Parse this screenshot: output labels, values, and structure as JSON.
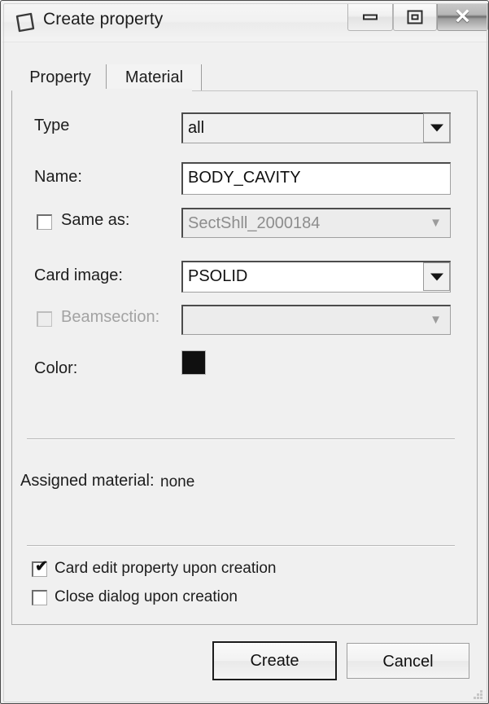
{
  "window": {
    "title": "Create property",
    "icon": "property-polygon-icon",
    "controls": {
      "minimize": "minimize-icon",
      "maximize": "maximize-icon",
      "close": "✕"
    }
  },
  "tabs": [
    {
      "label": "Property",
      "active": true
    },
    {
      "label": "Material",
      "active": false
    }
  ],
  "form": {
    "type": {
      "label": "Type",
      "value": "all",
      "enabled": true
    },
    "name": {
      "label": "Name:",
      "value": "BODY_CAVITY",
      "enabled": true
    },
    "same_as": {
      "label": "Same as:",
      "checked": false,
      "value": "SectShll_2000184",
      "enabled": false
    },
    "card_image": {
      "label": "Card image:",
      "value": "PSOLID",
      "enabled": true
    },
    "beamsection": {
      "label": "Beamsection:",
      "checked": false,
      "value": "",
      "enabled": false
    },
    "color": {
      "label": "Color:",
      "value": "#101010"
    },
    "assigned_material": {
      "label": "Assigned material:",
      "value": "none"
    }
  },
  "options": [
    {
      "label": "Card edit property upon creation",
      "checked": true
    },
    {
      "label": "Close dialog upon creation",
      "checked": false
    }
  ],
  "buttons": {
    "create": "Create",
    "cancel": "Cancel"
  }
}
